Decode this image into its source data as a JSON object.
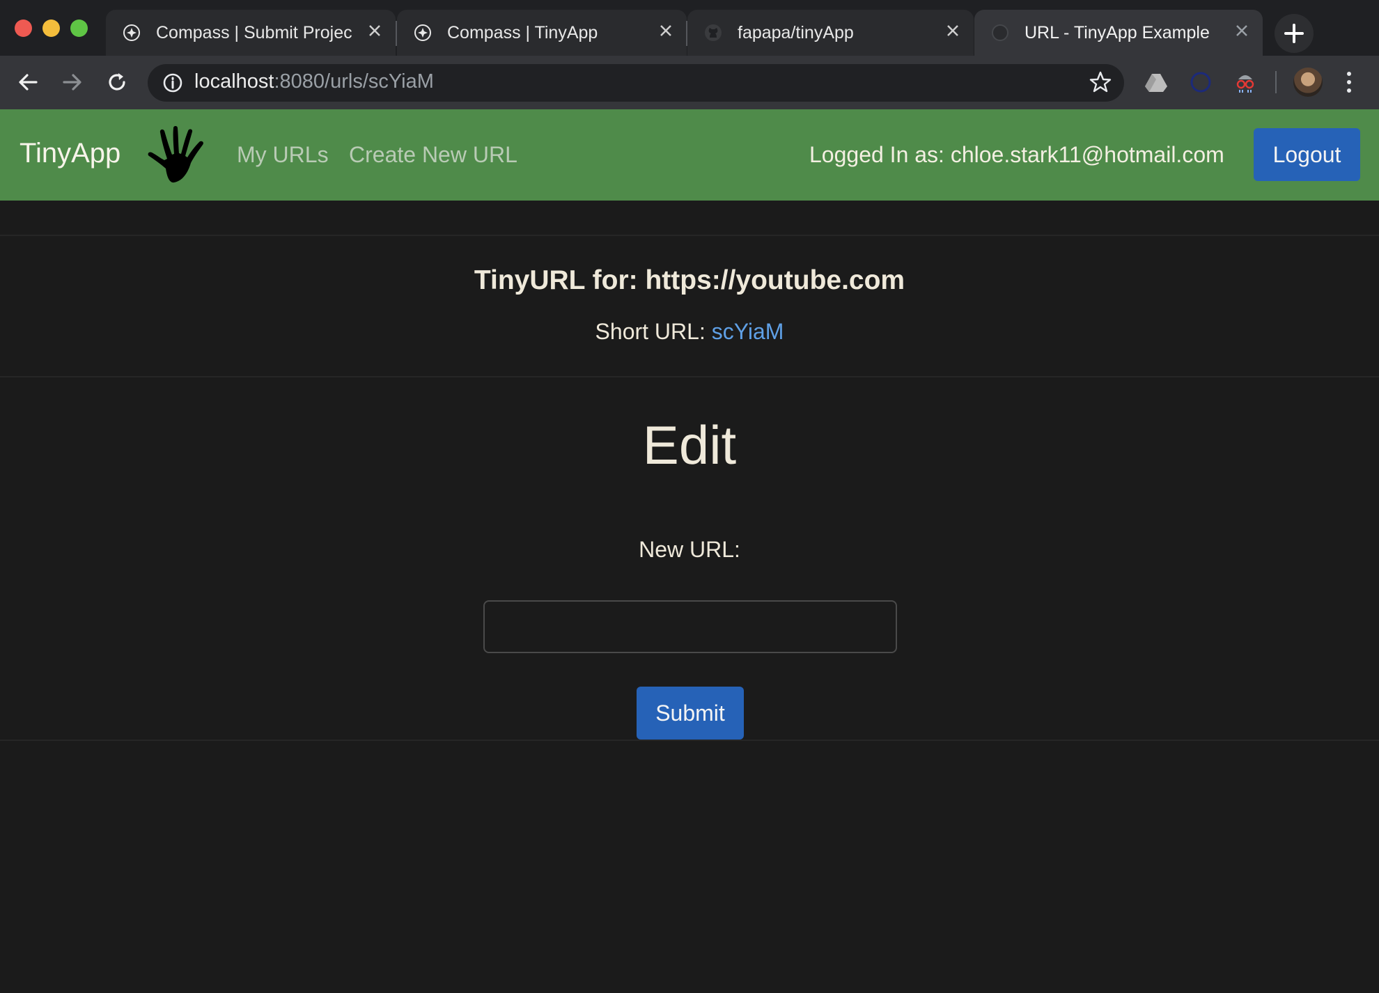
{
  "browser": {
    "tabs": [
      {
        "title": "Compass | Submit Projec",
        "favicon": "compass-icon",
        "active": false
      },
      {
        "title": "Compass | TinyApp",
        "favicon": "compass-icon",
        "active": false
      },
      {
        "title": "fapapa/tinyApp",
        "favicon": "github-icon",
        "active": false
      },
      {
        "title": "URL - TinyApp Example",
        "favicon": "globe-icon",
        "active": true
      }
    ],
    "address": {
      "host": "localhost",
      "path": ":8080/urls/scYiaM"
    }
  },
  "navbar": {
    "brand": "TinyApp",
    "links": [
      "My URLs",
      "Create New URL"
    ],
    "logged_in": "Logged In as: chloe.stark11@hotmail.com",
    "logout_label": "Logout",
    "accent": "#4f8b4a"
  },
  "main": {
    "tinyurl_label": "TinyURL for: https://youtube.com",
    "short_url_prefix": "Short URL: ",
    "short_url": "scYiaM",
    "edit_heading": "Edit",
    "new_url_label": "New URL:",
    "new_url_value": "",
    "submit_label": "Submit",
    "button_color": "#2662b7"
  }
}
